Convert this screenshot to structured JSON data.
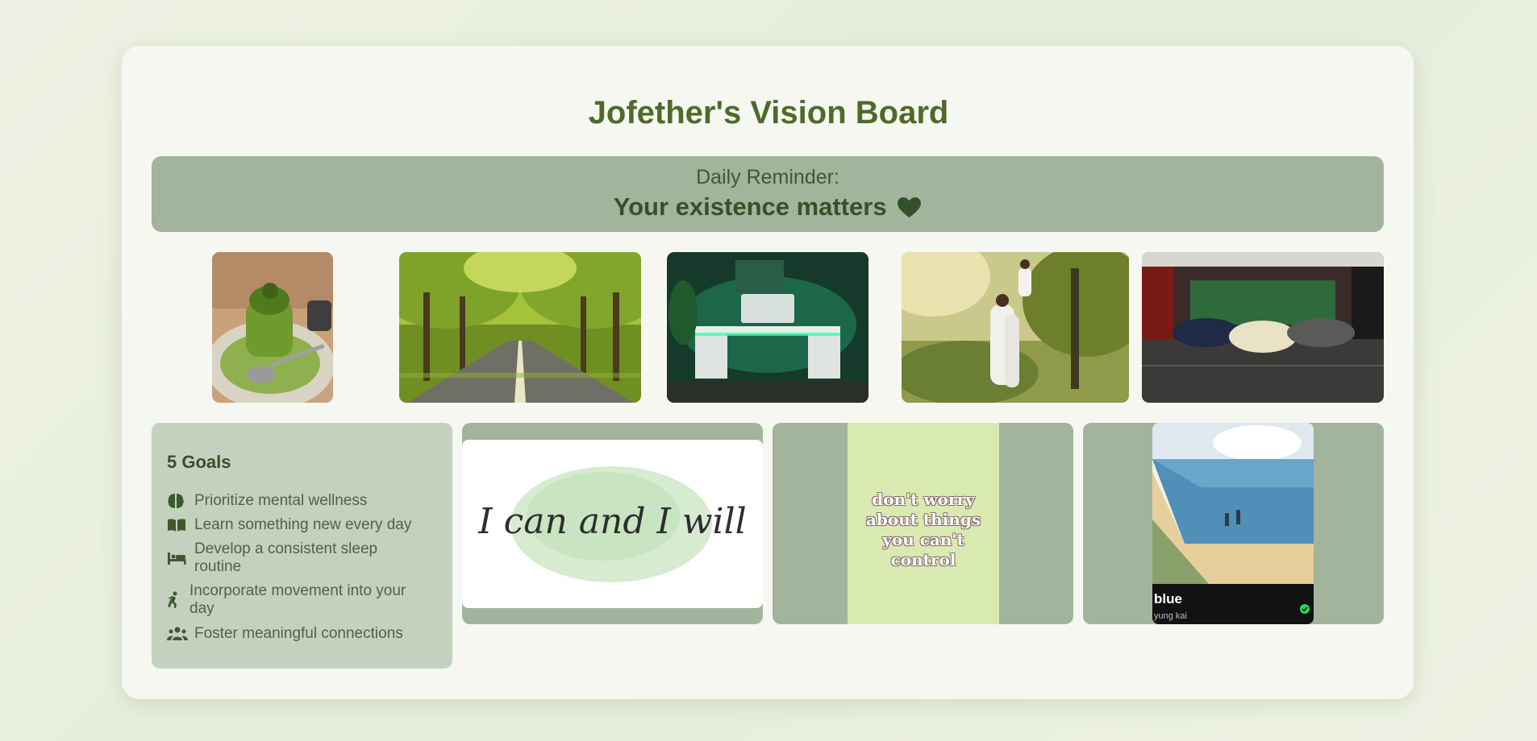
{
  "board": {
    "title": "Jofether's Vision Board"
  },
  "reminder": {
    "label": "Daily Reminder:",
    "message": "Your existence matters",
    "icon": "heart-icon"
  },
  "photos": [
    {
      "name": "matcha-pancakes-image"
    },
    {
      "name": "tree-lined-road-image"
    },
    {
      "name": "green-desk-setup-image"
    },
    {
      "name": "family-in-forest-image"
    },
    {
      "name": "luxury-car-garage-image"
    }
  ],
  "goals": {
    "heading": "5 Goals",
    "items": [
      {
        "label": "Prioritize mental wellness",
        "icon": "brain-icon"
      },
      {
        "label": "Learn something new every day",
        "icon": "book-icon"
      },
      {
        "label": "Develop a consistent sleep routine",
        "icon": "bed-icon"
      },
      {
        "label": "Incorporate movement into your day",
        "icon": "running-icon"
      },
      {
        "label": "Foster meaningful connections",
        "icon": "people-icon"
      }
    ]
  },
  "quote_tiles": {
    "affirmation_text": "I can and I will",
    "worry_text": [
      "don't worry",
      "about things",
      "you can't",
      "control"
    ]
  },
  "spotify": {
    "track": "blue",
    "artist": "yung kai",
    "saved_icon": "check-circle-icon"
  },
  "colors": {
    "title": "#4f6a2c",
    "accent_panel": "#a2b49c",
    "goals_panel": "#c5d1bf",
    "dark_green_text": "#34522a"
  }
}
